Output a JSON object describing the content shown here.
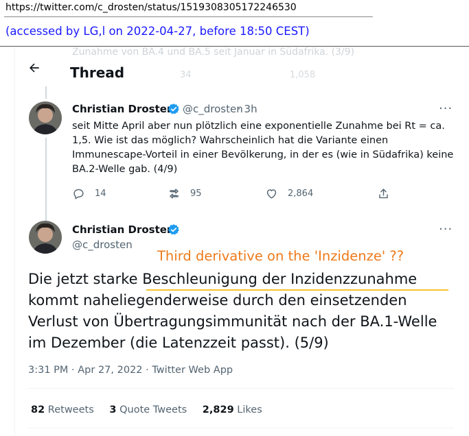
{
  "source_url": "https://twitter.com/c_drosten/status/1519308305172246530",
  "access_note": "(accessed by LG,l on 2022-04-27, before 18:50 CEST)",
  "previous_tweet_tail": "Zunahme von BA.4 und BA.5 seit Januar in Südafrika. (3/9)",
  "previous_counts": {
    "retweets": "34",
    "likes": "1,058"
  },
  "header": {
    "title": "Thread"
  },
  "reply_tweet": {
    "name": "Christian Drosten",
    "handle": "@c_drosten",
    "time": "· 3h",
    "text": "seit Mitte April aber nun plötzlich eine exponentielle Zunahme bei Rt = ca. 1,5. Wie ist das möglich? Wahrscheinlich hat die Variante einen Immunescape-Vorteil in einer Bevölkerung, in der es (wie in Südafrika) keine BA.2-Welle gab. (4/9)",
    "replies": "14",
    "retweets": "95",
    "likes": "2,864"
  },
  "main_tweet": {
    "name": "Christian Drosten",
    "handle": "@c_drosten",
    "text_before": "Die jetzt starke ",
    "text_highlight": "Beschleunigung der Inzidenzzunahme",
    "text_after": " kommt naheliegenderweise durch den einsetzenden Verlust von Übertragungsimmunität nach der BA.1-Welle im Dezember (die Latenzzeit passt). (5/9)",
    "meta": "3:31 PM · Apr 27, 2022 · Twitter Web App",
    "retweets_count": "82",
    "retweets_label": "Retweets",
    "quotes_count": "3",
    "quotes_label": "Quote Tweets",
    "likes_count": "2,829",
    "likes_label": "Likes"
  },
  "annotation": "Third derivative on the 'Inzidenze' ??",
  "more_glyph": "···",
  "colors": {
    "link_blue": "#1a1aff",
    "annotation_orange": "#ee7a1a",
    "highlight_yellow": "#f4c430",
    "verified_blue": "#1d9bf0"
  },
  "icons": [
    "back-arrow-icon",
    "verified-badge-icon",
    "more-icon",
    "reply-icon",
    "retweet-icon",
    "like-icon",
    "share-icon"
  ]
}
